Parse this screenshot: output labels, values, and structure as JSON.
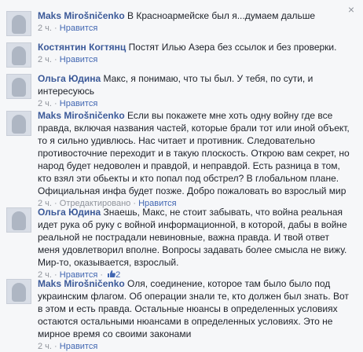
{
  "comments": [
    {
      "name": "Maks Mirošničenko",
      "text": "В Красноармейске был я...думаем дальше",
      "time": "2 ч.",
      "like": "Нравится"
    },
    {
      "name": "Костянтин Когтянц",
      "text": "Постят Илью Азера без ссылок и без проверки.",
      "time": "2 ч.",
      "like": "Нравится"
    },
    {
      "name": "Ольга Юдина",
      "text": "Макс, я понимаю, что ты был. У тебя, по сути, и интересуюсь",
      "time": "2 ч.",
      "like": "Нравится"
    },
    {
      "name": "Maks Mirošničenko",
      "text": "Если вы покажете мне хоть одну войну где все правда, включая названия частей, которые брали тот или иной объект, то я сильно удивлюсь. Нас читает и противник. Следовательно противосточние переходит и в такую плоскость. Открою вам секрет, но народ будет недоволен и правдой, и неправдой. Есть разница в том, кто взял эти обьекты и кто попал под обстрел? В глобальном плане. Официальная инфа будет позже. Добро пожаловать во взрослый мир",
      "time": "2 ч.",
      "edited": "Отредактировано",
      "like": "Нравится"
    },
    {
      "name": "Ольга Юдина",
      "text": "Знаешь, Макс, не стоит забывать, что война реальная идет рука об руку с войной информационной, в которой, дабы в войне реальной не пострадали невиновные, важна правда. И твой ответ меня удовлетворил вполне. Вопросы задавать более смысла не вижу. Мир-то, оказывается, взрослый.",
      "time": "2 ч.",
      "like": "Нравится",
      "like_count": "2"
    },
    {
      "name": "Maks Mirošničenko",
      "text": "Оля, соединение, которое там было было под украинским флагом. Об операции знали те, кто должен был знать. Вот в этом и есть правда. Остальные нюансы в определенных условиях остаются остальными нюансами в определенных условиях. Это не мирное время со своими законами",
      "time": "2 ч.",
      "like": "Нравится"
    }
  ],
  "close_symbol": "×",
  "sep": "·",
  "icons": {
    "close": "close-icon",
    "like": "thumbs-up-icon"
  },
  "colors": {
    "name": "#3b5998",
    "link": "#4267b2",
    "meta": "#90949c",
    "background": "#f6f7f9"
  }
}
